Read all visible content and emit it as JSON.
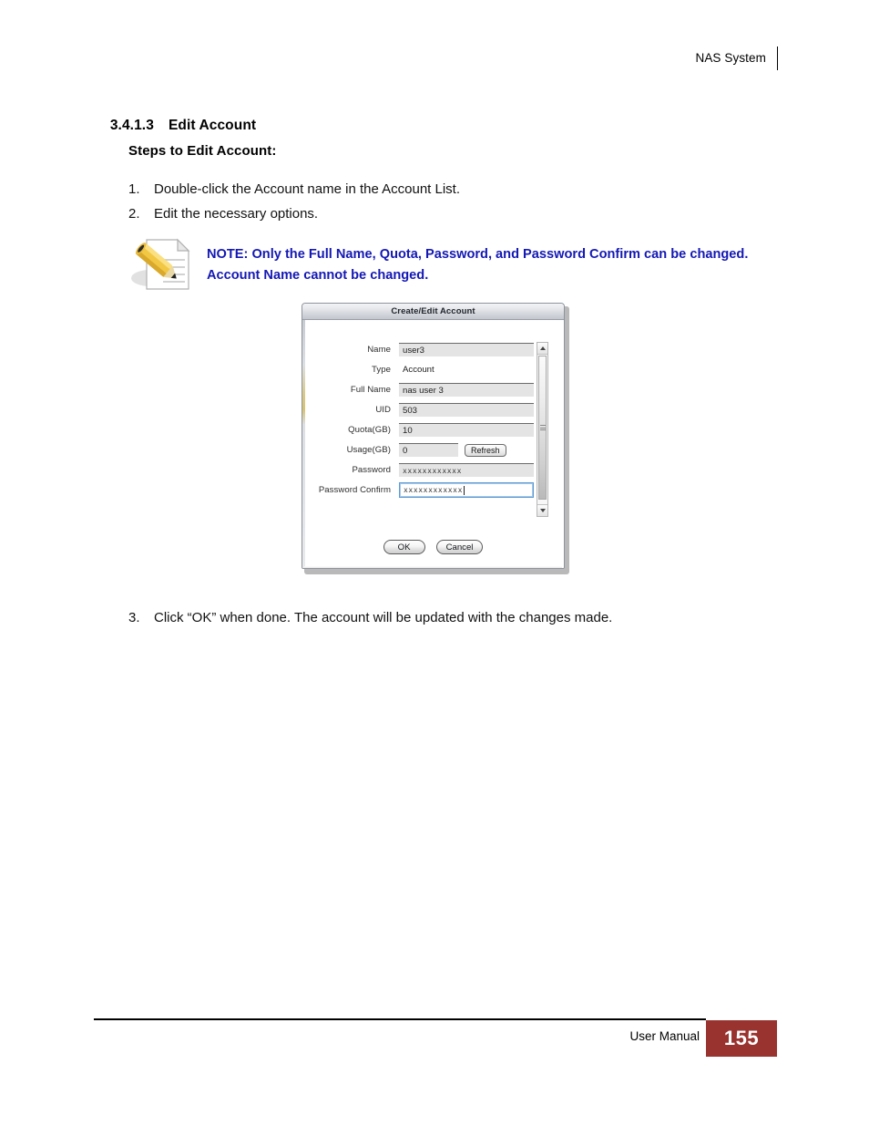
{
  "header": {
    "title": "NAS System"
  },
  "section": {
    "number": "3.4.1.3",
    "title": "Edit Account"
  },
  "sub_heading": "Steps to Edit Account:",
  "steps": [
    {
      "num": "1.",
      "text": "Double-click the Account name in the Account List."
    },
    {
      "num": "2.",
      "text": "Edit the necessary options."
    },
    {
      "num": "3.",
      "text": "Click “OK” when done. The account will be updated with the changes made."
    }
  ],
  "note": {
    "icon": "pencil-document-icon",
    "text": "NOTE: Only the Full Name, Quota, Password, and Password Confirm can be changed. Account Name cannot be changed.",
    "color": "#1418B4"
  },
  "dialog": {
    "title": "Create/Edit Account",
    "fields": [
      {
        "label": "Name",
        "value": "user3",
        "type": "readonly-input"
      },
      {
        "label": "Type",
        "value": "Account",
        "type": "static-text"
      },
      {
        "label": "Full Name",
        "value": "nas user 3",
        "type": "readonly-input"
      },
      {
        "label": "UID",
        "value": "503",
        "type": "readonly-input"
      },
      {
        "label": "Quota(GB)",
        "value": "10",
        "type": "readonly-input"
      },
      {
        "label": "Usage(GB)",
        "value": "0",
        "type": "readonly-input-with-button",
        "button": "Refresh"
      },
      {
        "label": "Password",
        "value": "xxxxxxxxxxxx",
        "type": "password"
      },
      {
        "label": "Password Confirm",
        "value": "xxxxxxxxxxxx",
        "type": "password-focused"
      }
    ],
    "buttons": {
      "ok": "OK",
      "cancel": "Cancel"
    },
    "scrollbar": {
      "up": "scroll-up-arrow",
      "down": "scroll-down-arrow"
    }
  },
  "footer": {
    "label": "User Manual",
    "page_number": "155",
    "badge_color": "#99332F"
  }
}
